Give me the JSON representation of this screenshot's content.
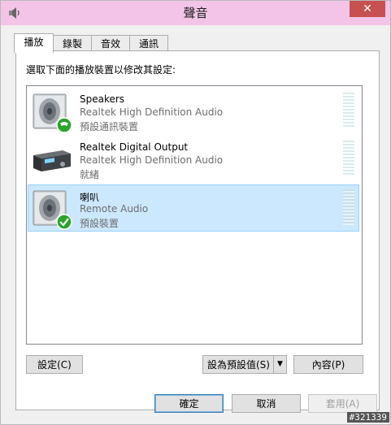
{
  "window": {
    "title": "聲音",
    "close_glyph": "✕",
    "icon": "sound-speaker-icon"
  },
  "tabs": [
    {
      "label": "播放",
      "active": true
    },
    {
      "label": "錄製",
      "active": false
    },
    {
      "label": "音效",
      "active": false
    },
    {
      "label": "通訊",
      "active": false
    }
  ],
  "instruction": "選取下面的播放裝置以修改其設定:",
  "devices": [
    {
      "name": "Speakers",
      "driver": "Realtek High Definition Audio",
      "status": "預設通訊裝置",
      "icon": "speaker-phone-icon",
      "selected": false
    },
    {
      "name": "Realtek Digital Output",
      "driver": "Realtek High Definition Audio",
      "status": "就緒",
      "icon": "digital-receiver-icon",
      "selected": false
    },
    {
      "name": "喇叭",
      "driver": "Remote Audio",
      "status": "預設裝置",
      "icon": "speaker-default-check-icon",
      "selected": true
    }
  ],
  "buttons": {
    "configure": "設定(C)",
    "set_default": "設為預設值(S)",
    "set_default_arrow": "▼",
    "properties": "內容(P)",
    "ok": "確定",
    "cancel": "取消",
    "apply": "套用(A)"
  },
  "watermark": "#321339",
  "colors": {
    "titlebar": "#f3c4e8",
    "close": "#c75050",
    "selection": "#cce8ff",
    "default_check": "#2aa52a",
    "phone_badge": "#2aa52a"
  }
}
